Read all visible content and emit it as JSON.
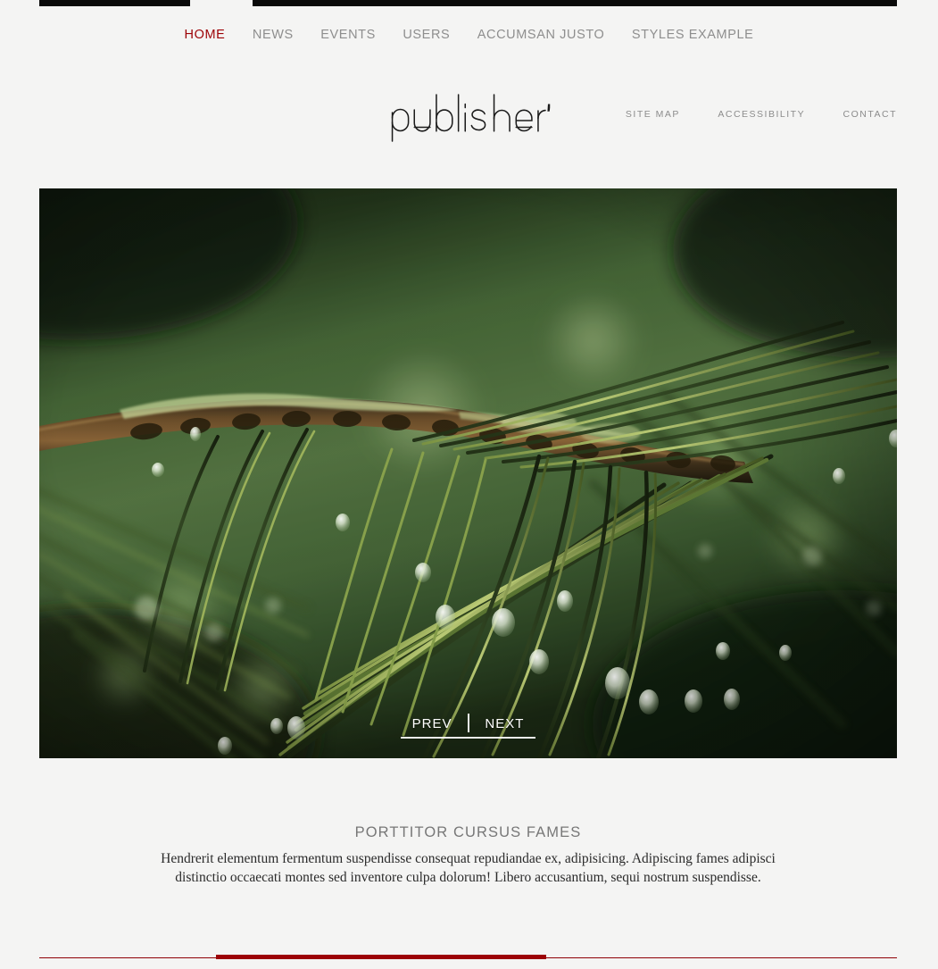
{
  "site": {
    "logo_text": "publisher's",
    "background_color": "#f4f4f3",
    "accent_color": "#9c0206",
    "bar_color": "#0a0a0a",
    "muted_text_color": "#8e8e8e"
  },
  "main_nav": {
    "items": [
      {
        "label": "HOME",
        "active": true
      },
      {
        "label": "NEWS",
        "active": false
      },
      {
        "label": "EVENTS",
        "active": false
      },
      {
        "label": "USERS",
        "active": false
      },
      {
        "label": "ACCUMSAN JUSTO",
        "active": false
      },
      {
        "label": "STYLES EXAMPLE",
        "active": false
      }
    ]
  },
  "utility_nav": {
    "items": [
      {
        "label": "SITE MAP"
      },
      {
        "label": "ACCESSIBILITY"
      },
      {
        "label": "CONTACT"
      }
    ]
  },
  "hero": {
    "image_description": "Macro photograph of a pine branch with long green needles covered in water droplets against a blurred green background",
    "controls": {
      "prev_label": "PREV",
      "next_label": "NEXT"
    }
  },
  "intro": {
    "title": "PORTTITOR CURSUS FAMES",
    "body": "Hendrerit elementum fermentum suspendisse consequat repudiandae ex, adipisicing. Adipiscing fames adipisci distinctio occaecati montes sed inventore culpa dolorum! Libero accusantium, sequi nostrum suspendisse."
  }
}
